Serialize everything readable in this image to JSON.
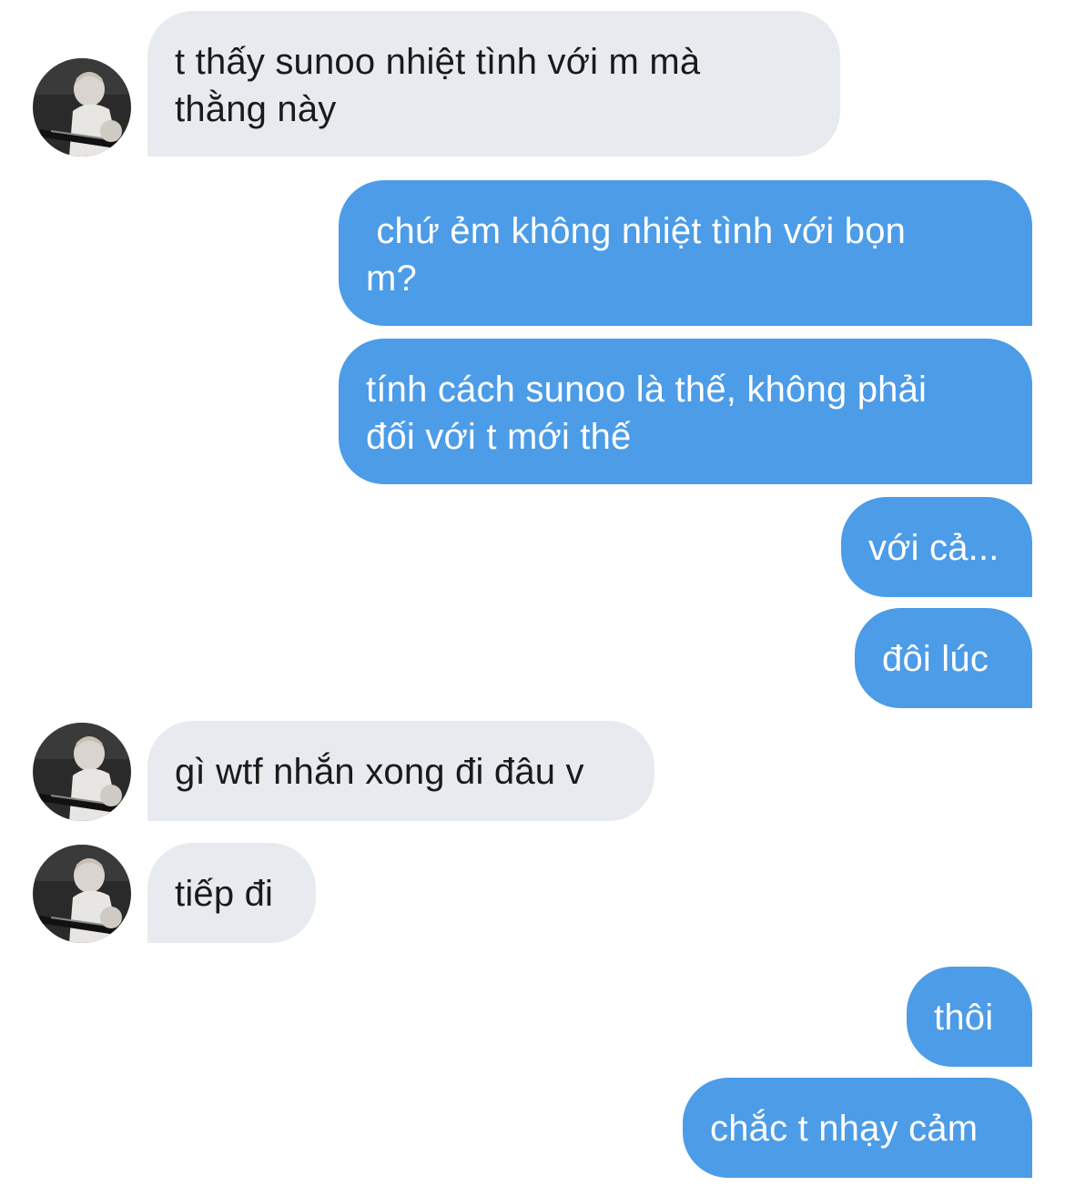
{
  "messages": [
    {
      "side": "in",
      "avatar": "avatar-photo",
      "text": "t thấy sunoo nhiệt tình với m mà\nthằng này"
    },
    {
      "side": "out",
      "text": " chứ ẻm không nhiệt tình với bọn\nm?"
    },
    {
      "side": "out",
      "text": "tính cách sunoo là thế, không phải\nđối với t mới thế"
    },
    {
      "side": "out",
      "text": "với cả..."
    },
    {
      "side": "out",
      "text": "đôi lúc"
    },
    {
      "side": "in",
      "avatar": "avatar-photo",
      "text": "gì wtf nhắn xong đi đâu v"
    },
    {
      "side": "in",
      "avatar": "avatar-photo",
      "text": "tiếp đi"
    },
    {
      "side": "out",
      "text": "thôi"
    },
    {
      "side": "out",
      "text": "chắc t nhạy cảm"
    }
  ],
  "colors": {
    "incoming_bubble": "#e7ebef",
    "outgoing_bubble": "#4c9ce8",
    "incoming_text": "#1a1a1a",
    "outgoing_text": "#ffffff"
  }
}
